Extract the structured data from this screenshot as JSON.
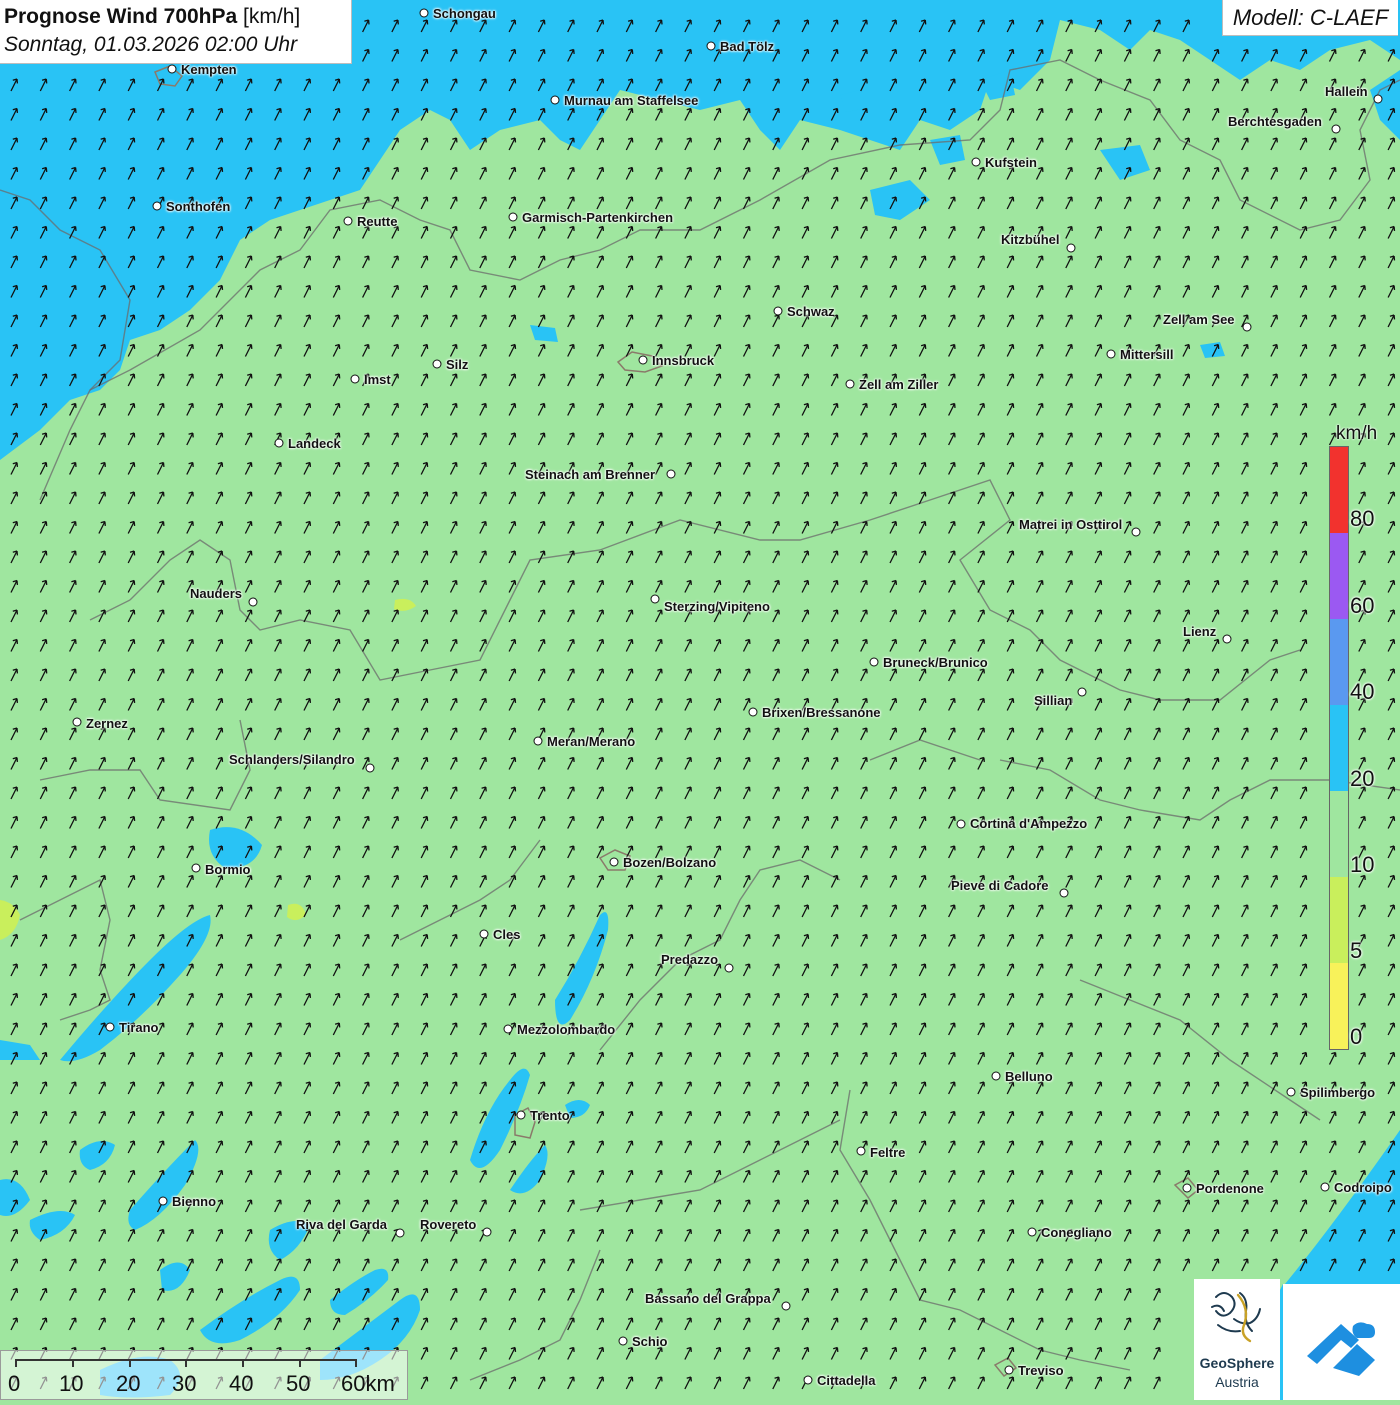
{
  "header": {
    "title_bold": "Prognose Wind 700hPa",
    "title_unit": "[km/h]",
    "subtitle": "Sonntag, 01.03.2026 02:00 Uhr",
    "model": "Modell: C-LAEF"
  },
  "wind": {
    "arrow_direction": "north-east",
    "dominant_range": "10-20 km/h"
  },
  "cities": [
    {
      "name": "Schongau"
    },
    {
      "name": "Bad Tölz"
    },
    {
      "name": "Kempten"
    },
    {
      "name": "Murnau am Staffelsee"
    },
    {
      "name": "Hallein"
    },
    {
      "name": "Berchtesgaden"
    },
    {
      "name": "Kufstein"
    },
    {
      "name": "Sonthofen"
    },
    {
      "name": "Reutte"
    },
    {
      "name": "Garmisch-Partenkirchen"
    },
    {
      "name": "Kitzbühel"
    },
    {
      "name": "Schwaz"
    },
    {
      "name": "Zell am See"
    },
    {
      "name": "Mittersill"
    },
    {
      "name": "Innsbruck"
    },
    {
      "name": "Silz"
    },
    {
      "name": "Imst"
    },
    {
      "name": "Zell am Ziller"
    },
    {
      "name": "Landeck"
    },
    {
      "name": "Steinach am Brenner"
    },
    {
      "name": "Matrei in Osttirol"
    },
    {
      "name": "Nauders"
    },
    {
      "name": "Sterzing/Vipiteno"
    },
    {
      "name": "Lienz"
    },
    {
      "name": "Bruneck/Brunico"
    },
    {
      "name": "Sillian"
    },
    {
      "name": "Zernez"
    },
    {
      "name": "Brixen/Bressanone"
    },
    {
      "name": "Meran/Merano"
    },
    {
      "name": "Schlanders/Silandro"
    },
    {
      "name": "Cortina d'Ampezzo"
    },
    {
      "name": "Bormio"
    },
    {
      "name": "Bozen/Bolzano"
    },
    {
      "name": "Pieve di Cadore"
    },
    {
      "name": "Cles"
    },
    {
      "name": "Predazzo"
    },
    {
      "name": "Tirano"
    },
    {
      "name": "Mezzolombardo"
    },
    {
      "name": "Belluno"
    },
    {
      "name": "Spilimbergo"
    },
    {
      "name": "Trento"
    },
    {
      "name": "Feltre"
    },
    {
      "name": "Pordenone"
    },
    {
      "name": "Codroipo"
    },
    {
      "name": "Bienno"
    },
    {
      "name": "Riva del Garda"
    },
    {
      "name": "Rovereto"
    },
    {
      "name": "Conegliano"
    },
    {
      "name": "Bassano del Grappa"
    },
    {
      "name": "Schio"
    },
    {
      "name": "Treviso"
    },
    {
      "name": "Cittadella"
    }
  ],
  "legend": {
    "unit": "km/h",
    "levels": [
      {
        "label": "80",
        "color": "#f2322e"
      },
      {
        "label": "60",
        "color": "#9b59f2"
      },
      {
        "label": "40",
        "color": "#5a99f0"
      },
      {
        "label": "20",
        "color": "#29c3f5"
      },
      {
        "label": "10",
        "color": "#9fe69f"
      },
      {
        "label": "5",
        "color": "#c9ef5c"
      },
      {
        "label": "0",
        "color": "#f8f25a"
      }
    ],
    "top_color": "#f2322e"
  },
  "scale": {
    "labels": [
      "0",
      "10",
      "20",
      "30",
      "40",
      "50",
      "60km"
    ]
  },
  "logo": {
    "name_line1": "GeoSphere",
    "name_line2": "Austria"
  },
  "colors": {
    "wind_10_20": "#9fe69f",
    "wind_20_40": "#29c3f5",
    "arrow": "#111111"
  }
}
